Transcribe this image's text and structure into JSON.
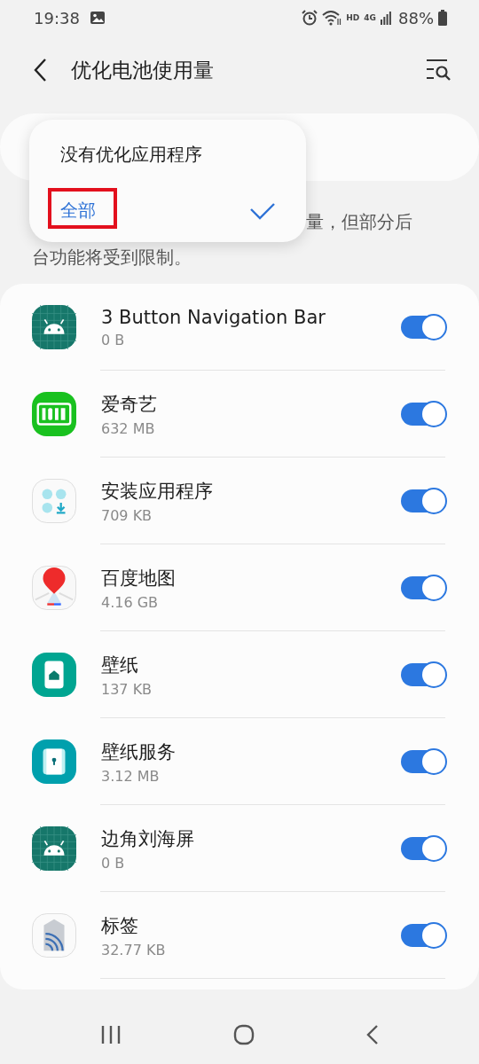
{
  "status_bar": {
    "time": "19:38",
    "hd_label": "HD",
    "network_label": "4G",
    "battery": "88%"
  },
  "header": {
    "title": "优化电池使用量"
  },
  "filter_menu": {
    "items": [
      {
        "label": "没有优化应用程序",
        "selected": false,
        "highlighted": false
      },
      {
        "label": "全部",
        "selected": true,
        "highlighted": true
      }
    ]
  },
  "description": {
    "lines": [
      "量，但部分后",
      "台功能将受到限制。"
    ]
  },
  "apps": [
    {
      "kind": "android",
      "name": "3 Button Navigation Bar",
      "size": "0 B",
      "on": true
    },
    {
      "kind": "video",
      "name": "爱奇艺",
      "size": "632 MB",
      "on": true
    },
    {
      "kind": "installer",
      "name": "安装应用程序",
      "size": "709 KB",
      "on": true
    },
    {
      "kind": "map",
      "name": "百度地图",
      "size": "4.16 GB",
      "on": true
    },
    {
      "kind": "wallpaper",
      "name": "壁纸",
      "size": "137 KB",
      "on": true
    },
    {
      "kind": "lock",
      "name": "壁纸服务",
      "size": "3.12 MB",
      "on": true
    },
    {
      "kind": "android",
      "name": "边角刘海屏",
      "size": "0 B",
      "on": true
    },
    {
      "kind": "tag",
      "name": "标签",
      "size": "32.77 KB",
      "on": true
    }
  ]
}
